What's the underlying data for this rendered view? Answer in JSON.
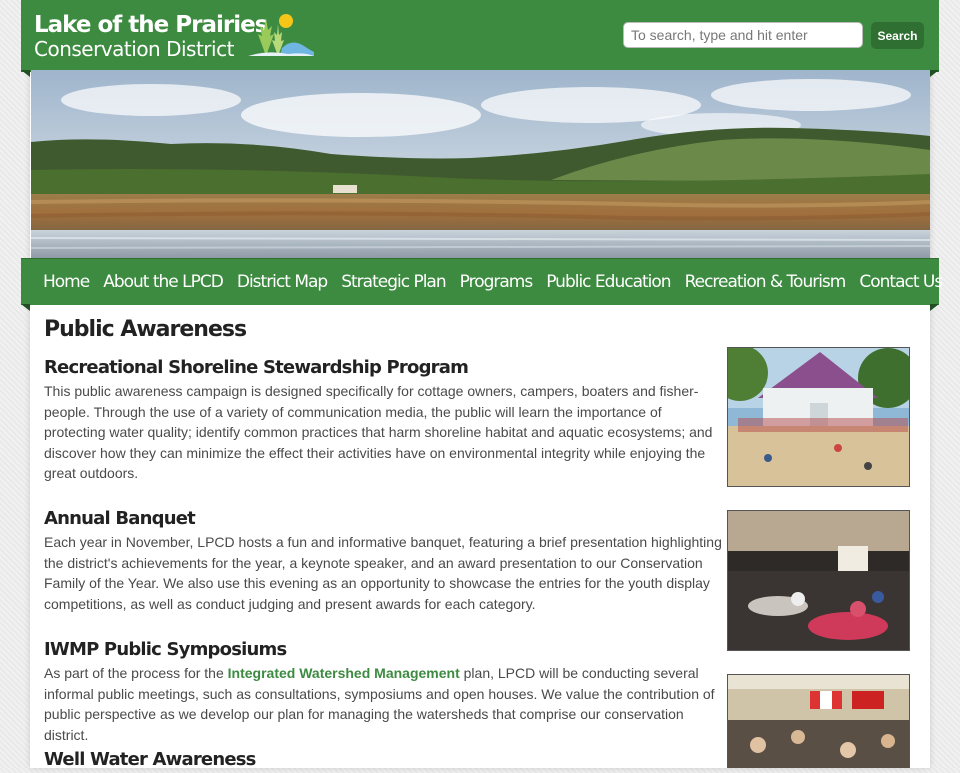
{
  "header": {
    "logo_line1": "Lake of the Prairies",
    "logo_line2": "Conservation District",
    "search_placeholder": "To search, type and hit enter",
    "search_button": "Search"
  },
  "nav": {
    "items": [
      {
        "label": "Home"
      },
      {
        "label": "About the LPCD"
      },
      {
        "label": "District Map"
      },
      {
        "label": "Strategic Plan"
      },
      {
        "label": "Programs"
      },
      {
        "label": "Public Education"
      },
      {
        "label": "Recreation & Tourism"
      },
      {
        "label": "Contact Us"
      }
    ]
  },
  "main": {
    "title": "Public Awareness",
    "sections": [
      {
        "heading": "Recreational Shoreline Stewardship Program",
        "body": "This public awareness campaign is designed specifically for cottage owners, campers, boaters and fisher-people. Through the use of a variety of communication media, the public will learn the importance of protecting water quality; identify common practices that harm shoreline habitat and aquatic ecosystems; and discover how they can minimize the effect their activities have on environmental integrity while enjoying the great outdoors."
      },
      {
        "heading": "Annual Banquet",
        "body": "Each year in November, LPCD hosts a fun and informative banquet, featuring a brief presentation highlighting the district's achievements for the year, a keynote speaker, and an award presentation to our Conservation Family of the Year. We also use this evening as an opportunity to showcase the entries for the youth display competitions, as well as conduct judging and present awards for each category."
      },
      {
        "heading": "IWMP Public Symposiums",
        "body_before": "As part of the process for the ",
        "link": "Integrated Watershed Management",
        "body_after": " plan, LPCD will be conducting several informal public meetings, such as consultations, symposiums and open houses. We value the contribution of public perspective as we develop our plan for managing the watersheds that comprise our conservation district."
      },
      {
        "heading": "Well Water Awareness"
      }
    ]
  },
  "colors": {
    "brand_green": "#3d8b40",
    "dark_green": "#2f7032",
    "link_green": "#3d8b40"
  }
}
